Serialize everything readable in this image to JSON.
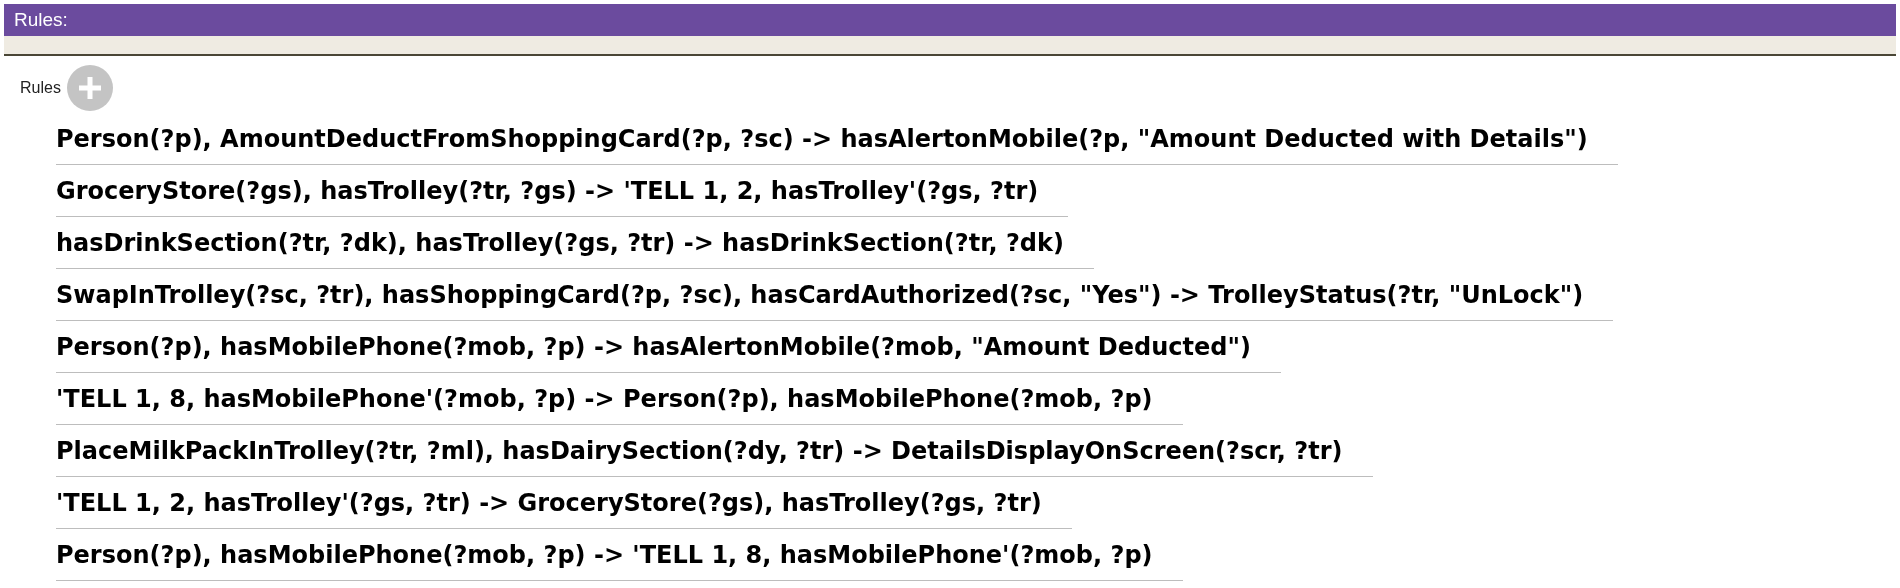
{
  "header": {
    "title": "Rules:"
  },
  "section": {
    "label": "Rules"
  },
  "rules": [
    "Person(?p), AmountDeductFromShoppingCard(?p, ?sc) -> hasAlertonMobile(?p, \"Amount Deducted with Details\")",
    "GroceryStore(?gs), hasTrolley(?tr, ?gs) -> 'TELL 1, 2, hasTrolley'(?gs, ?tr)",
    "hasDrinkSection(?tr, ?dk), hasTrolley(?gs, ?tr) -> hasDrinkSection(?tr, ?dk)",
    "SwapInTrolley(?sc, ?tr), hasShoppingCard(?p, ?sc), hasCardAuthorized(?sc, \"Yes\") -> TrolleyStatus(?tr, \"UnLock\")",
    "Person(?p), hasMobilePhone(?mob, ?p) -> hasAlertonMobile(?mob, \"Amount Deducted\")",
    "'TELL 1, 8, hasMobilePhone'(?mob, ?p) -> Person(?p), hasMobilePhone(?mob, ?p)",
    "PlaceMilkPackInTrolley(?tr, ?ml), hasDairySection(?dy, ?tr) -> DetailsDisplayOnScreen(?scr, ?tr)",
    "'TELL 1, 2, hasTrolley'(?gs, ?tr) -> GroceryStore(?gs), hasTrolley(?gs, ?tr)",
    "Person(?p), hasMobilePhone(?mob, ?p) -> 'TELL 1, 8, hasMobilePhone'(?mob, ?p)"
  ]
}
